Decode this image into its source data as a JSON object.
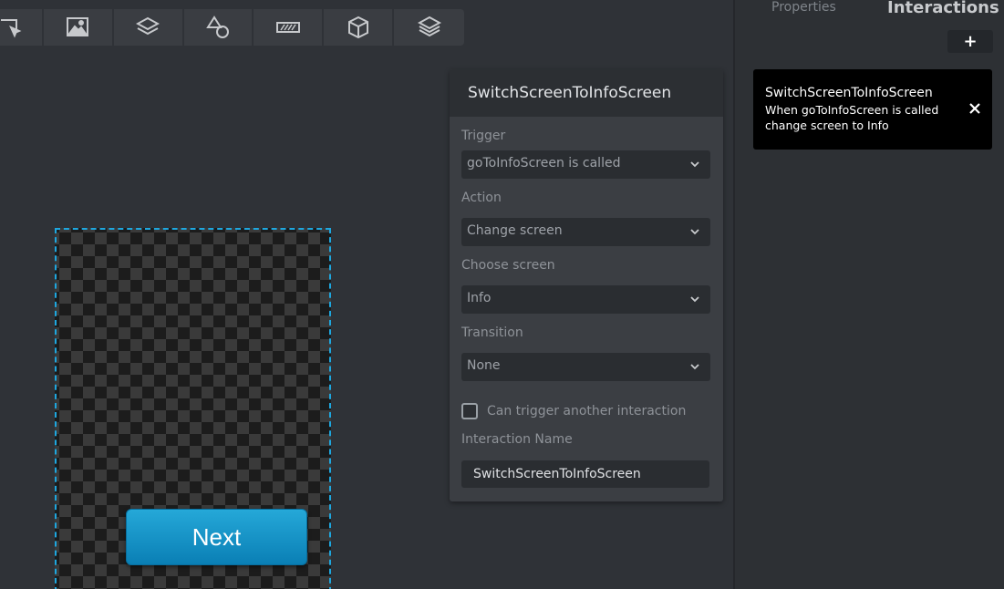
{
  "toolbar": {
    "tools": [
      {
        "icon": "screen-interaction-icon"
      },
      {
        "icon": "image-icon"
      },
      {
        "icon": "layers-icon"
      },
      {
        "icon": "shapes-icon"
      },
      {
        "icon": "progress-icon"
      },
      {
        "icon": "3d-box-icon"
      },
      {
        "icon": "stacked-layers-icon"
      }
    ]
  },
  "canvas": {
    "next_button_label": "Next"
  },
  "edit_panel": {
    "title": "SwitchScreenToInfoScreen",
    "trigger_label": "Trigger",
    "trigger_value": "goToInfoScreen is called",
    "action_label": "Action",
    "action_value": "Change screen",
    "screen_label": "Choose screen",
    "screen_value": "Info",
    "transition_label": "Transition",
    "transition_value": "None",
    "checkbox_label": "Can trigger another interaction",
    "name_label": "Interaction Name",
    "name_value": "SwitchScreenToInfoScreen"
  },
  "sidebar": {
    "tab_properties": "Properties",
    "tab_interactions": "Interactions",
    "add_label": "+",
    "card": {
      "title": "SwitchScreenToInfoScreen",
      "line1": "When goToInfoScreen is called",
      "line2": "change screen to Info"
    }
  },
  "colors": {
    "accent": "#1ea7df",
    "button": "#0a7fb5"
  }
}
